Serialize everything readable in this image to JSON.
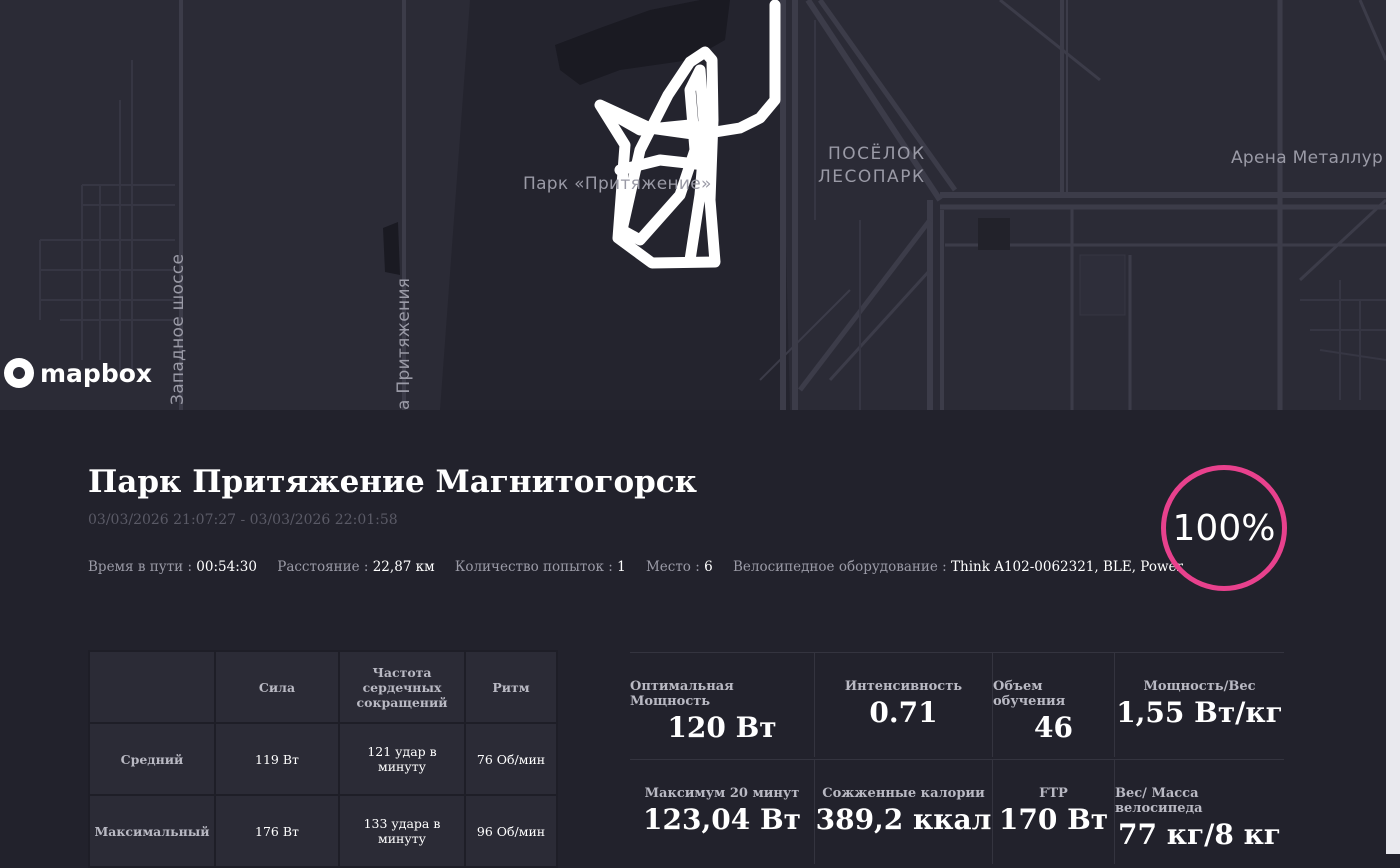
{
  "map": {
    "labels": {
      "park": "Парк «Притяжение»",
      "poselok_line1": "ПОСЁЛОК",
      "poselok_line2": "ЛЕСОПАРК",
      "arena": "Арена Металлур",
      "zapadnoe": "Западное шоссе",
      "prityazheniya": "а Притяжения"
    },
    "attribution": "mapbox"
  },
  "ride": {
    "title": "Парк Притяжение Магнитогорск",
    "datetime": "03/03/2026 21:07:27 - 03/03/2026 22:01:58",
    "progress": "100%",
    "meta": [
      {
        "label": "Время в пути : ",
        "value": "00:54:30"
      },
      {
        "label": "Расстояние : ",
        "value": "22,87 км"
      },
      {
        "label": "Количество попыток : ",
        "value": "1"
      },
      {
        "label": "Место : ",
        "value": "6"
      },
      {
        "label": "Велосипедное оборудование : ",
        "value": "Think A102-0062321, BLE, Power"
      }
    ]
  },
  "stats_table": {
    "headers": [
      "",
      "Сила",
      "Частота сердечных сокращений",
      "Ритм"
    ],
    "rows": [
      {
        "label": "Средний",
        "power": "119 Вт",
        "hr": "121 удар в минуту",
        "cadence": "76 Об/мин"
      },
      {
        "label": "Максимальный",
        "power": "176 Вт",
        "hr": "133 удара в минуту",
        "cadence": "96 Об/мин"
      }
    ]
  },
  "metrics": {
    "row1": [
      {
        "label": "Оптимальная Мощность",
        "value": "120 Вт"
      },
      {
        "label": "Интенсивность",
        "value": "0.71"
      },
      {
        "label": "Объем обучения",
        "value": "46"
      },
      {
        "label": "Мощность/Вес",
        "value": "1,55 Вт/кг"
      }
    ],
    "row2": [
      {
        "label": "Максимум 20 минут",
        "value": "123,04 Вт"
      },
      {
        "label": "Сожженные калории",
        "value": "389,2 ккал"
      },
      {
        "label": "FTP",
        "value": "170 Вт"
      },
      {
        "label": "Вес/ Масса велосипеда",
        "value": "77 кг/8 кг"
      }
    ]
  },
  "colors": {
    "accent": "#e8418d",
    "background": "#22222c",
    "map": "#2b2b36"
  }
}
